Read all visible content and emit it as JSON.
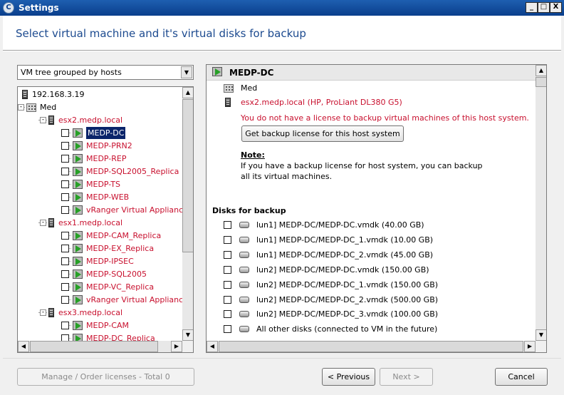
{
  "window": {
    "title": "Settings",
    "icon_letter": "C",
    "controls": {
      "minimize": "_",
      "maximize": "□",
      "close": "X"
    }
  },
  "header": {
    "title": "Select virtual machine and it's virtual disks for backup"
  },
  "tree_view_select": {
    "selected": "VM tree grouped by hosts"
  },
  "tree": {
    "nodes": [
      {
        "label": "192.168.3.19",
        "icon": "server-icon",
        "color": "default"
      },
      {
        "label": "Med",
        "icon": "building-icon",
        "color": "default"
      },
      {
        "label": "esx2.medp.local",
        "icon": "server-icon",
        "color": "red"
      },
      {
        "label": "MEDP-DC",
        "icon": "vm-icon",
        "color": "selected"
      },
      {
        "label": "MEDP-PRN2",
        "icon": "vm-icon",
        "color": "red"
      },
      {
        "label": "MEDP-REP",
        "icon": "vm-icon",
        "color": "red"
      },
      {
        "label": "MEDP-SQL2005_Replica",
        "icon": "vm-icon",
        "color": "red"
      },
      {
        "label": "MEDP-TS",
        "icon": "vm-icon",
        "color": "red"
      },
      {
        "label": "MEDP-WEB",
        "icon": "vm-icon",
        "color": "red"
      },
      {
        "label": "vRanger Virtual Appliance",
        "icon": "vm-icon",
        "color": "red"
      },
      {
        "label": "esx1.medp.local",
        "icon": "server-icon",
        "color": "red"
      },
      {
        "label": "MEDP-CAM_Replica",
        "icon": "vm-icon",
        "color": "red"
      },
      {
        "label": "MEDP-EX_Replica",
        "icon": "vm-icon",
        "color": "red"
      },
      {
        "label": "MEDP-IPSEC",
        "icon": "vm-icon",
        "color": "red"
      },
      {
        "label": "MEDP-SQL2005",
        "icon": "vm-icon",
        "color": "red"
      },
      {
        "label": "MEDP-VC_Replica",
        "icon": "vm-icon",
        "color": "red"
      },
      {
        "label": "vRanger Virtual Appliance",
        "icon": "vm-icon",
        "color": "red"
      },
      {
        "label": "esx3.medp.local",
        "icon": "server-icon",
        "color": "red"
      },
      {
        "label": "MEDP-CAM",
        "icon": "vm-icon",
        "color": "red"
      },
      {
        "label": "MEDP-DC_Replica",
        "icon": "vm-icon",
        "color": "red"
      }
    ]
  },
  "detail": {
    "title": "MEDP-DC",
    "datacenter": "Med",
    "host": "esx2.medp.local (HP, ProLiant DL380 G5)",
    "license_warning": "You do not have a license to backup virtual machines of this host system.",
    "get_license_button": "Get backup license for this host system",
    "note_label": "Note:",
    "note_line1": "If you have a backup license for host system, you can backup",
    "note_line2": "all its virtual machines.",
    "disks_header": "Disks for backup",
    "disks": [
      "lun1] MEDP-DC/MEDP-DC.vmdk (40.00 GB)",
      "lun1] MEDP-DC/MEDP-DC_1.vmdk (10.00 GB)",
      "lun1] MEDP-DC/MEDP-DC_2.vmdk (45.00 GB)",
      "lun2] MEDP-DC/MEDP-DC.vmdk (150.00 GB)",
      "lun2] MEDP-DC/MEDP-DC_1.vmdk (150.00 GB)",
      "lun2] MEDP-DC/MEDP-DC_2.vmdk (500.00 GB)",
      "lun2] MEDP-DC/MEDP-DC_3.vmdk (100.00 GB)",
      "All other disks (connected to VM in the future)"
    ]
  },
  "footer": {
    "manage_licenses": "Manage / Order licenses - Total 0",
    "previous": "< Previous",
    "next": "Next >",
    "cancel": "Cancel"
  },
  "colors": {
    "title_bar": "#0a3e8c",
    "header_text": "#1c4a8f",
    "warning_red": "#c8102e",
    "selection": "#0a246a"
  }
}
